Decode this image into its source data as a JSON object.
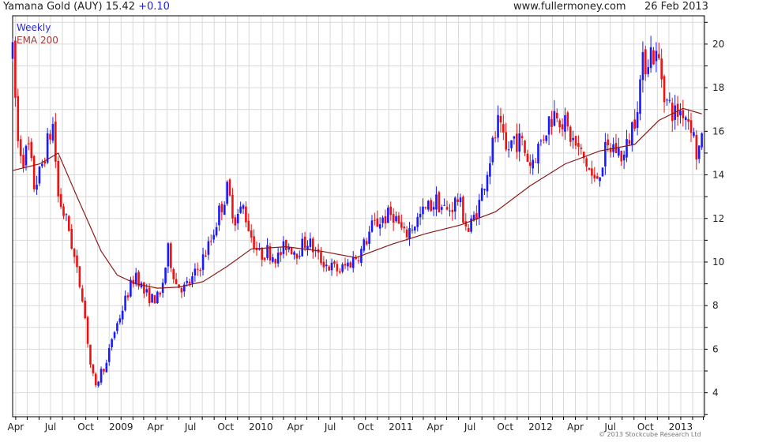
{
  "header": {
    "title": "Yamana Gold (AUY)",
    "price": "15.42",
    "change": "+0.10",
    "source": "www.fullermoney.com",
    "date": "26 Feb 2013"
  },
  "legend": {
    "weekly": "Weekly",
    "ema": "EMA 200"
  },
  "copyright": "© 2013 Stockcube Research Ltd",
  "colors": {
    "up": "#1a1aff",
    "down": "#ee1111",
    "ema": "#8b1a1a",
    "grid": "#d9d9d9"
  },
  "chart_data": {
    "type": "candlestick",
    "title": "Yamana Gold (AUY) 15.42 +0.10",
    "interval": "Weekly",
    "indicator": "EMA 200",
    "y_ticks": [
      4,
      6,
      8,
      10,
      12,
      14,
      16,
      18,
      20
    ],
    "ylim": [
      2.9,
      21.3
    ],
    "y_axis_side": "right",
    "grid": true,
    "x_ticks": [
      "Apr",
      "Jul",
      "Oct",
      "2009",
      "Apr",
      "Jul",
      "Oct",
      "2010",
      "Apr",
      "Jul",
      "Oct",
      "2011",
      "Apr",
      "Jul",
      "Oct",
      "2012",
      "Apr",
      "Jul",
      "Oct",
      "2013"
    ],
    "x_range": [
      "2008-03-24",
      "2013-03-04"
    ],
    "price_path": [
      [
        "2008-03-24",
        19.5
      ],
      [
        "2008-04-07",
        15.5
      ],
      [
        "2008-04-21",
        14.8
      ],
      [
        "2008-05-05",
        15.2
      ],
      [
        "2008-05-19",
        13.5
      ],
      [
        "2008-06-02",
        14.0
      ],
      [
        "2008-06-16",
        15.0
      ],
      [
        "2008-07-07",
        16.3
      ],
      [
        "2008-07-21",
        13.0
      ],
      [
        "2008-08-18",
        11.5
      ],
      [
        "2008-09-08",
        9.5
      ],
      [
        "2008-09-22",
        8.5
      ],
      [
        "2008-10-13",
        5.3
      ],
      [
        "2008-10-27",
        4.2
      ],
      [
        "2008-11-10",
        5.0
      ],
      [
        "2008-11-24",
        5.3
      ],
      [
        "2008-12-08",
        6.5
      ],
      [
        "2008-12-29",
        7.5
      ],
      [
        "2009-01-19",
        8.6
      ],
      [
        "2009-02-09",
        9.5
      ],
      [
        "2009-03-02",
        8.6
      ],
      [
        "2009-03-23",
        8.3
      ],
      [
        "2009-04-13",
        8.4
      ],
      [
        "2009-05-04",
        10.5
      ],
      [
        "2009-05-25",
        9.0
      ],
      [
        "2009-06-15",
        8.8
      ],
      [
        "2009-07-06",
        9.2
      ],
      [
        "2009-07-27",
        9.9
      ],
      [
        "2009-08-24",
        11.0
      ],
      [
        "2009-09-14",
        12.3
      ],
      [
        "2009-10-05",
        13.3
      ],
      [
        "2009-10-26",
        12.0
      ],
      [
        "2009-11-16",
        12.5
      ],
      [
        "2009-12-07",
        11.2
      ],
      [
        "2009-12-28",
        10.3
      ],
      [
        "2010-01-18",
        10.5
      ],
      [
        "2010-02-15",
        10.2
      ],
      [
        "2010-03-08",
        10.8
      ],
      [
        "2010-04-05",
        10.5
      ],
      [
        "2010-05-03",
        11.0
      ],
      [
        "2010-05-31",
        10.2
      ],
      [
        "2010-06-28",
        9.8
      ],
      [
        "2010-07-26",
        9.6
      ],
      [
        "2010-08-23",
        10.0
      ],
      [
        "2010-09-20",
        10.5
      ],
      [
        "2010-10-18",
        11.6
      ],
      [
        "2010-11-15",
        12.0
      ],
      [
        "2010-12-13",
        12.2
      ],
      [
        "2011-01-10",
        11.2
      ],
      [
        "2011-02-07",
        11.8
      ],
      [
        "2011-03-07",
        12.4
      ],
      [
        "2011-04-04",
        12.8
      ],
      [
        "2011-05-02",
        12.3
      ],
      [
        "2011-05-30",
        12.9
      ],
      [
        "2011-06-27",
        11.4
      ],
      [
        "2011-07-25",
        12.7
      ],
      [
        "2011-08-22",
        14.8
      ],
      [
        "2011-09-12",
        16.3
      ],
      [
        "2011-10-03",
        15.0
      ],
      [
        "2011-10-24",
        15.7
      ],
      [
        "2011-11-14",
        15.4
      ],
      [
        "2011-12-05",
        14.5
      ],
      [
        "2012-01-02",
        15.5
      ],
      [
        "2012-01-23",
        16.5
      ],
      [
        "2012-02-13",
        17.0
      ],
      [
        "2012-03-12",
        16.0
      ],
      [
        "2012-04-02",
        15.3
      ],
      [
        "2012-04-30",
        14.5
      ],
      [
        "2012-05-21",
        13.6
      ],
      [
        "2012-06-18",
        15.0
      ],
      [
        "2012-07-09",
        15.3
      ],
      [
        "2012-08-06",
        14.8
      ],
      [
        "2012-09-03",
        16.7
      ],
      [
        "2012-09-24",
        19.0
      ],
      [
        "2012-10-15",
        19.7
      ],
      [
        "2012-11-05",
        19.2
      ],
      [
        "2012-11-26",
        17.3
      ],
      [
        "2012-12-17",
        16.8
      ],
      [
        "2013-01-07",
        17.0
      ],
      [
        "2013-01-28",
        16.4
      ],
      [
        "2013-02-11",
        15.0
      ],
      [
        "2013-02-25",
        15.4
      ]
    ],
    "series": [
      {
        "name": "Weekly",
        "kind": "candles",
        "up_color": "blue",
        "down_color": "red"
      },
      {
        "name": "EMA 200",
        "kind": "line",
        "values": [
          [
            "2008-03-24",
            14.2
          ],
          [
            "2008-06-02",
            14.5
          ],
          [
            "2008-07-21",
            15.0
          ],
          [
            "2008-09-08",
            13.0
          ],
          [
            "2008-11-10",
            10.5
          ],
          [
            "2008-12-22",
            9.4
          ],
          [
            "2009-02-09",
            9.0
          ],
          [
            "2009-04-06",
            8.8
          ],
          [
            "2009-06-01",
            8.85
          ],
          [
            "2009-08-03",
            9.1
          ],
          [
            "2009-10-05",
            9.8
          ],
          [
            "2009-12-07",
            10.6
          ],
          [
            "2010-03-08",
            10.7
          ],
          [
            "2010-06-07",
            10.5
          ],
          [
            "2010-09-06",
            10.2
          ],
          [
            "2010-12-06",
            10.8
          ],
          [
            "2011-03-07",
            11.3
          ],
          [
            "2011-06-06",
            11.7
          ],
          [
            "2011-09-05",
            12.3
          ],
          [
            "2011-12-05",
            13.5
          ],
          [
            "2012-03-05",
            14.5
          ],
          [
            "2012-06-04",
            15.1
          ],
          [
            "2012-09-03",
            15.4
          ],
          [
            "2012-11-05",
            16.5
          ],
          [
            "2013-01-07",
            17.05
          ],
          [
            "2013-02-25",
            16.8
          ]
        ]
      }
    ]
  }
}
